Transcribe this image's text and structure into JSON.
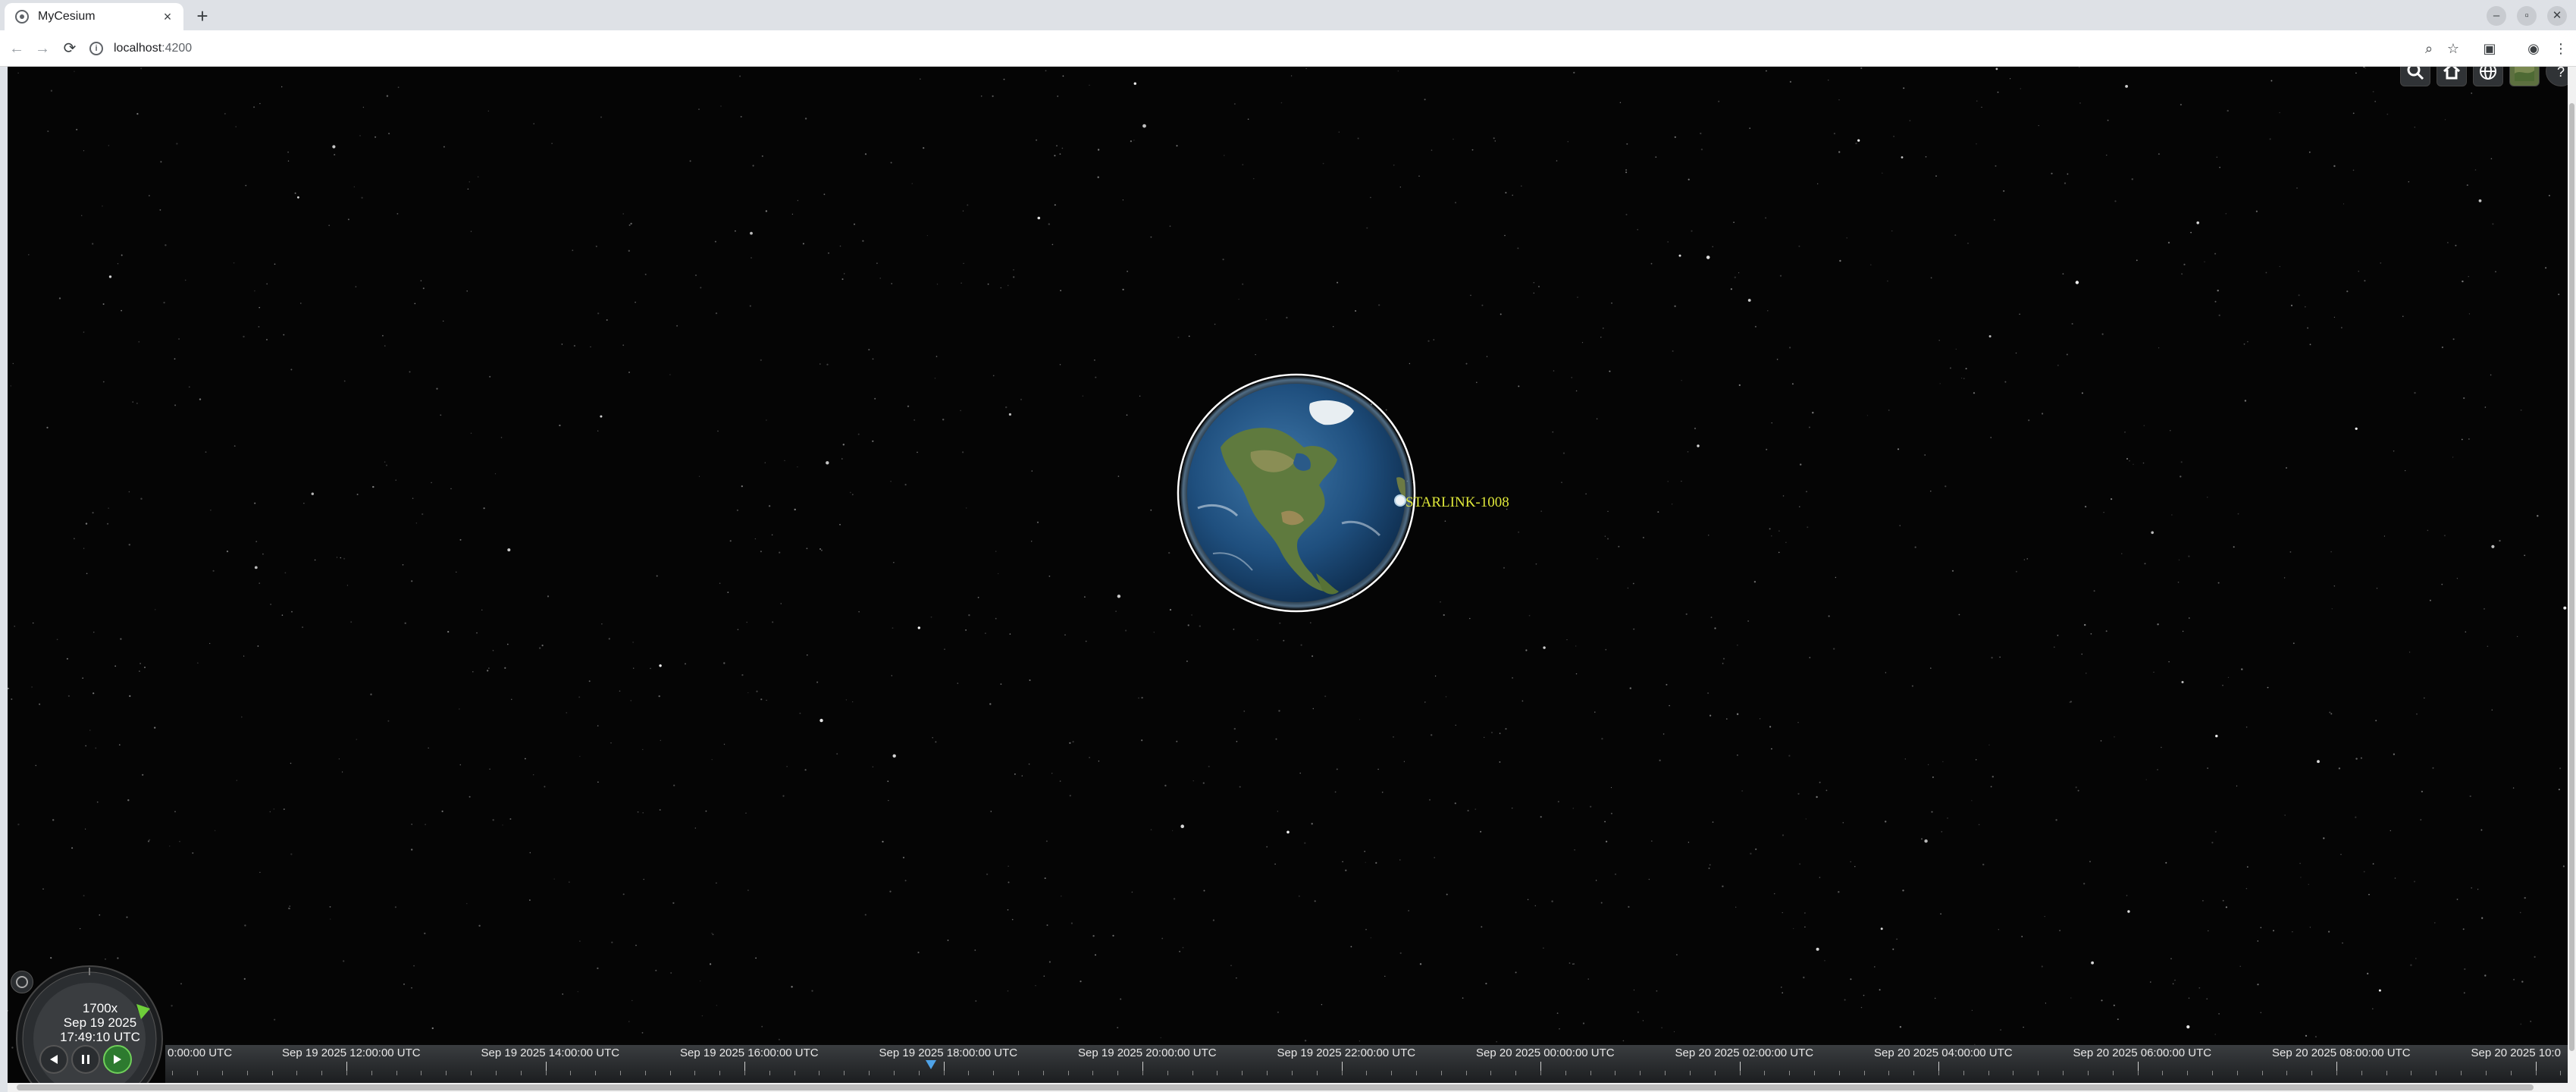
{
  "browser": {
    "tab_title": "MyCesium",
    "tab_close": "×",
    "new_tab": "+",
    "url_host": "localhost",
    "url_port": ":4200",
    "window_controls": [
      "–",
      "▫",
      "✕"
    ]
  },
  "viewer": {
    "satellite_label": "STARLINK-1008",
    "toolbar_buttons": [
      "search-icon",
      "home-icon",
      "globe-icon",
      "layers-icon",
      "help-icon"
    ]
  },
  "animation": {
    "speed": "1700x",
    "date": "Sep 19 2025",
    "time": "17:49:10 UTC"
  },
  "timeline": {
    "labels": [
      "0:00:00 UTC",
      "Sep 19 2025 12:00:00 UTC",
      "Sep 19 2025 14:00:00 UTC",
      "Sep 19 2025 16:00:00 UTC",
      "Sep 19 2025 18:00:00 UTC",
      "Sep 19 2025 20:00:00 UTC",
      "Sep 19 2025 22:00:00 UTC",
      "Sep 20 2025 00:00:00 UTC",
      "Sep 20 2025 02:00:00 UTC",
      "Sep 20 2025 04:00:00 UTC",
      "Sep 20 2025 06:00:00 UTC",
      "Sep 20 2025 08:00:00 UTC",
      "Sep 20 2025 10:0"
    ]
  },
  "colors": {
    "label": "#e0e93a",
    "space": "#050505",
    "play_active": "#2d7a2f"
  }
}
